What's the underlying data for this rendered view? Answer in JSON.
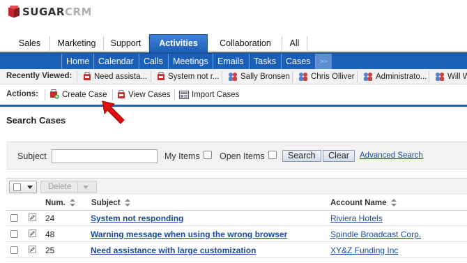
{
  "brand": {
    "logo_main": "SUGAR",
    "logo_accent": "CRM"
  },
  "top_tabs": [
    "Sales",
    "Marketing",
    "Support",
    "Activities",
    "Collaboration",
    "All"
  ],
  "sub_nav": [
    "Home",
    "Calendar",
    "Calls",
    "Meetings",
    "Emails",
    "Tasks",
    "Cases",
    ">>"
  ],
  "recently_viewed": {
    "label": "Recently Viewed:",
    "items": [
      {
        "label": "Need assista...",
        "icon": "case-icon"
      },
      {
        "label": "System not r...",
        "icon": "case-icon"
      },
      {
        "label": "Sally Bronsen",
        "icon": "contact-icon"
      },
      {
        "label": "Chris Olliver",
        "icon": "contact-icon"
      },
      {
        "label": "Administrato...",
        "icon": "contact-icon"
      },
      {
        "label": "Will W",
        "icon": "contact-icon"
      }
    ]
  },
  "actions": {
    "label": "Actions:",
    "items": [
      {
        "label": "Create Case",
        "icon": "create-case-icon"
      },
      {
        "label": "View Cases",
        "icon": "case-icon"
      },
      {
        "label": "Import Cases",
        "icon": "import-icon"
      }
    ]
  },
  "page_title": "Search Cases",
  "search": {
    "subject_label": "Subject",
    "subject_value": "",
    "my_items_label": "My Items",
    "open_items_label": "Open Items",
    "search_button": "Search",
    "clear_button": "Clear",
    "advanced_link": "Advanced Search"
  },
  "list": {
    "delete_button": "Delete",
    "columns": [
      "Num.",
      "Subject",
      "Account Name"
    ],
    "rows": [
      {
        "num": "24",
        "subject": "System not responding",
        "account": "Riviera Hotels"
      },
      {
        "num": "48",
        "subject": "Warning message when using the wrong browser",
        "account": "Spindle Broadcast Corp."
      },
      {
        "num": "25",
        "subject": "Need assistance with large customization",
        "account": "XY&Z Funding Inc"
      }
    ]
  },
  "colors": {
    "accent_blue": "#1b5fb6",
    "link_blue": "#1a4aa0",
    "arrow_red": "#e01010",
    "logo_red": "#c0272d"
  }
}
